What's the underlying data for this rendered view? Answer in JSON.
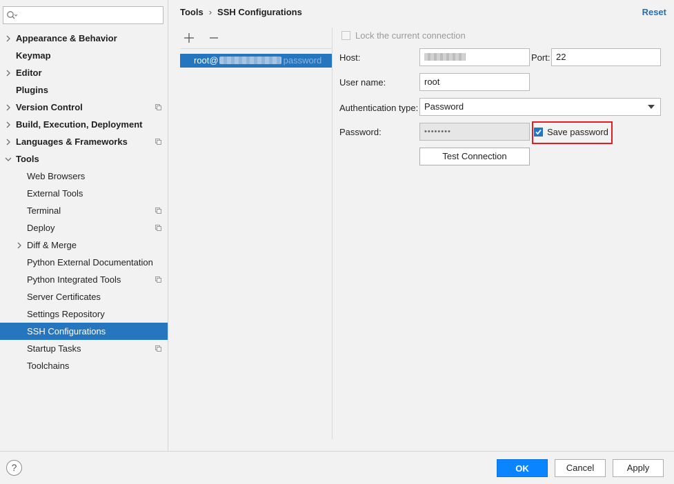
{
  "search": {
    "placeholder": "",
    "value": ""
  },
  "sidebar": {
    "items": [
      {
        "label": "Appearance & Behavior",
        "expandable": true,
        "project_icon": false
      },
      {
        "label": "Keymap",
        "expandable": false,
        "project_icon": false
      },
      {
        "label": "Editor",
        "expandable": true,
        "project_icon": false
      },
      {
        "label": "Plugins",
        "expandable": false,
        "project_icon": false
      },
      {
        "label": "Version Control",
        "expandable": true,
        "project_icon": true
      },
      {
        "label": "Build, Execution, Deployment",
        "expandable": true,
        "project_icon": false
      },
      {
        "label": "Languages & Frameworks",
        "expandable": true,
        "project_icon": true
      },
      {
        "label": "Tools",
        "expandable": true,
        "expanded": true,
        "project_icon": false
      }
    ],
    "tools_children": [
      {
        "label": "Web Browsers",
        "project_icon": false
      },
      {
        "label": "External Tools",
        "project_icon": false
      },
      {
        "label": "Terminal",
        "project_icon": true
      },
      {
        "label": "Deploy",
        "project_icon": true
      },
      {
        "label": "Diff & Merge",
        "expandable": true,
        "project_icon": false
      },
      {
        "label": "Python External Documentation",
        "project_icon": false
      },
      {
        "label": "Python Integrated Tools",
        "project_icon": true
      },
      {
        "label": "Server Certificates",
        "project_icon": false
      },
      {
        "label": "Settings Repository",
        "project_icon": false
      },
      {
        "label": "SSH Configurations",
        "selected": true,
        "project_icon": false
      },
      {
        "label": "Startup Tasks",
        "project_icon": true
      },
      {
        "label": "Toolchains",
        "project_icon": false
      }
    ]
  },
  "header": {
    "breadcrumb": [
      "Tools",
      "SSH Configurations"
    ],
    "reset_label": "Reset"
  },
  "ssh_list": {
    "add_icon": "plus-icon",
    "remove_icon": "minus-icon",
    "entries": [
      {
        "user_prefix": "root@",
        "host": "(redacted)",
        "auth": "password",
        "selected": true
      }
    ]
  },
  "form": {
    "lock_label": "Lock the current connection",
    "lock_checked": false,
    "host_label": "Host:",
    "host_value": "(redacted)",
    "port_label": "Port:",
    "port_value": "22",
    "username_label": "User name:",
    "username_value": "root",
    "auth_type_label": "Authentication type:",
    "auth_type_value": "Password",
    "password_label": "Password:",
    "password_value": "••••••••",
    "save_password_label": "Save password",
    "save_password_checked": true,
    "test_connection_label": "Test Connection"
  },
  "footer": {
    "help_label": "?",
    "ok_label": "OK",
    "cancel_label": "Cancel",
    "apply_label": "Apply"
  },
  "colors": {
    "selection": "#2675bf",
    "primary_button": "#0a84ff",
    "highlight_box": "#e31b23",
    "link": "#2470b3"
  }
}
